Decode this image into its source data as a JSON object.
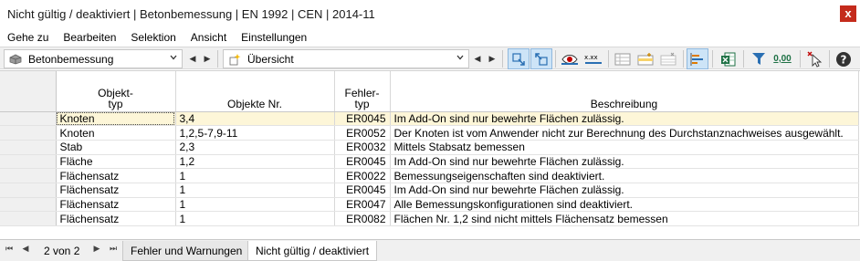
{
  "window": {
    "title": "Nicht gültig / deaktiviert | Betonbemessung | EN 1992 | CEN | 2014-11",
    "close_glyph": "x"
  },
  "menu": [
    "Gehe zu",
    "Bearbeiten",
    "Selektion",
    "Ansicht",
    "Einstellungen"
  ],
  "toolbar": {
    "module_combo": "Betonbemessung",
    "view_combo": "Übersicht",
    "value_label": "0,00"
  },
  "table": {
    "headers": {
      "objekttyp_line1": "Objekt-",
      "objekttyp_line2": "typ",
      "objekte": "Objekte Nr.",
      "fehler_line1": "Fehler-",
      "fehler_line2": "typ",
      "beschreibung": "Beschreibung"
    },
    "rows": [
      {
        "typ": "Knoten",
        "nr": "3,4",
        "code": "ER0045",
        "desc": "Im Add-On sind nur bewehrte Flächen zulässig."
      },
      {
        "typ": "Knoten",
        "nr": "1,2,5-7,9-11",
        "code": "ER0052",
        "desc": "Der Knoten ist vom Anwender nicht zur Berechnung des Durchstanznachweises ausgewählt."
      },
      {
        "typ": "Stab",
        "nr": "2,3",
        "code": "ER0032",
        "desc": "Mittels Stabsatz bemessen"
      },
      {
        "typ": "Fläche",
        "nr": "1,2",
        "code": "ER0045",
        "desc": "Im Add-On sind nur bewehrte Flächen zulässig."
      },
      {
        "typ": "Flächensatz",
        "nr": "1",
        "code": "ER0022",
        "desc": "Bemessungseigenschaften sind deaktiviert."
      },
      {
        "typ": "Flächensatz",
        "nr": "1",
        "code": "ER0045",
        "desc": "Im Add-On sind nur bewehrte Flächen zulässig."
      },
      {
        "typ": "Flächensatz",
        "nr": "1",
        "code": "ER0047",
        "desc": "Alle Bemessungskonfigurationen sind deaktiviert."
      },
      {
        "typ": "Flächensatz",
        "nr": "1",
        "code": "ER0082",
        "desc": "Flächen Nr. 1,2 sind nicht mittels Flächensatz bemessen"
      }
    ]
  },
  "tabs": {
    "page_info": "2 von 2",
    "items": [
      "Fehler und Warnungen",
      "Nicht gültig / deaktiviert"
    ]
  },
  "colors": {
    "selected_row": "#fdf6d8",
    "close_button": "#c42b1c",
    "active_tool": "#cde4f7"
  }
}
